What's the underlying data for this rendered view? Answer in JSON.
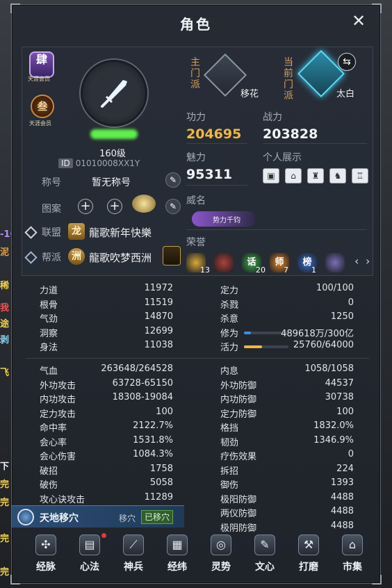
{
  "window": {
    "title": "角色"
  },
  "profile": {
    "badge_top": "肆",
    "badge_top_sub": "天涯会员",
    "badge_round": "叁",
    "badge_round_sub": "天涯会员",
    "level": "160级",
    "id_label": "ID",
    "id_value": "01010008XX1Y",
    "title_label": "称号",
    "title_value": "暂无称号",
    "emblem_label": "图案",
    "alliance_label": "联盟",
    "alliance_emblem": "龙",
    "alliance_name": "龍歌新年快樂",
    "guild_label": "帮派",
    "guild_emblem": "洲",
    "guild_name": "龍歌吹梦西洲"
  },
  "sects": {
    "main_label": "主门派",
    "main_name": "移花",
    "current_label": "当前门派",
    "current_name": "太白"
  },
  "stats": {
    "gongli_label": "功力",
    "gongli_value": "204695",
    "zhanli_label": "战力",
    "zhanli_value": "203828",
    "meili_label": "魅力",
    "meili_value": "95311",
    "show_label": "个人展示",
    "weiming_label": "威名",
    "weiming_badge": "势力千钧",
    "honor_label": "荣誉",
    "honors": [
      {
        "icon": "crown-icon",
        "count": "13",
        "color": "#d9a93a"
      },
      {
        "icon": "chest-icon",
        "count": "",
        "color": "#b0403a"
      },
      {
        "icon": "hua-icon",
        "text": "话",
        "count": "20",
        "color": "#3fa84a"
      },
      {
        "icon": "shi-icon",
        "text": "师",
        "count": "7",
        "color": "#e0862a"
      },
      {
        "icon": "bang-icon",
        "text": "榜",
        "count": "1",
        "color": "#3a6fc8"
      },
      {
        "icon": "medal-icon",
        "count": "",
        "color": "#7a6fb8"
      }
    ]
  },
  "attributes_top_left": [
    {
      "k": "力道",
      "v": "11972"
    },
    {
      "k": "根骨",
      "v": "11519"
    },
    {
      "k": "气劲",
      "v": "14870"
    },
    {
      "k": "洞察",
      "v": "12699"
    },
    {
      "k": "身法",
      "v": "11038"
    }
  ],
  "attributes_top_right": [
    {
      "k": "定力",
      "v": "100/100"
    },
    {
      "k": "杀戮",
      "v": "0"
    },
    {
      "k": "杀意",
      "v": "1250"
    },
    {
      "k": "修为",
      "v": "489618万/300亿",
      "bar": 0.16,
      "bar_color": "#3d8fe0"
    },
    {
      "k": "活力",
      "v": "25760/64000",
      "bar": 0.4025,
      "bar_color": "#f2b643"
    }
  ],
  "attributes_bottom_left": [
    {
      "k": "气血",
      "v": "263648/264528"
    },
    {
      "k": "外功攻击",
      "v": "63728-65150"
    },
    {
      "k": "内功攻击",
      "v": "18308-19084"
    },
    {
      "k": "定力攻击",
      "v": "100"
    },
    {
      "k": "命中率",
      "v": "2122.7%"
    },
    {
      "k": "会心率",
      "v": "1531.8%"
    },
    {
      "k": "会心伤害",
      "v": "1084.3%"
    },
    {
      "k": "破招",
      "v": "1758"
    },
    {
      "k": "破伤",
      "v": "5058"
    },
    {
      "k": "攻心诀攻击",
      "v": "11289"
    }
  ],
  "attributes_bottom_right": [
    {
      "k": "内息",
      "v": "1058/1058"
    },
    {
      "k": "外功防御",
      "v": "44537"
    },
    {
      "k": "内功防御",
      "v": "30738"
    },
    {
      "k": "定力防御",
      "v": "100"
    },
    {
      "k": "格挡",
      "v": "1832.0%"
    },
    {
      "k": "韧劲",
      "v": "1346.9%"
    },
    {
      "k": "疗伤效果",
      "v": "0"
    },
    {
      "k": "拆招",
      "v": "224"
    },
    {
      "k": "御伤",
      "v": "1393"
    },
    {
      "k": "极阳防御",
      "v": "4488"
    },
    {
      "k": "两仪防御",
      "v": "4488"
    },
    {
      "k": "极阴防御",
      "v": "4488"
    }
  ],
  "taskbar": {
    "label": "天地移穴",
    "sub": "移穴",
    "button": "已移穴"
  },
  "nav": [
    {
      "label": "经脉",
      "icon": "meridian-icon",
      "glyph": "✣"
    },
    {
      "label": "心法",
      "icon": "book-icon",
      "glyph": "▤",
      "dot": true
    },
    {
      "label": "神兵",
      "icon": "blade-icon",
      "glyph": "⟋"
    },
    {
      "label": "经纬",
      "icon": "grid-icon",
      "glyph": "▦"
    },
    {
      "label": "灵势",
      "icon": "swirl-icon",
      "glyph": "◎"
    },
    {
      "label": "文心",
      "icon": "brush-icon",
      "glyph": "✎"
    },
    {
      "label": "打磨",
      "icon": "hammer-icon",
      "glyph": "⚒"
    },
    {
      "label": "市集",
      "icon": "market-icon",
      "glyph": "⌂"
    }
  ]
}
